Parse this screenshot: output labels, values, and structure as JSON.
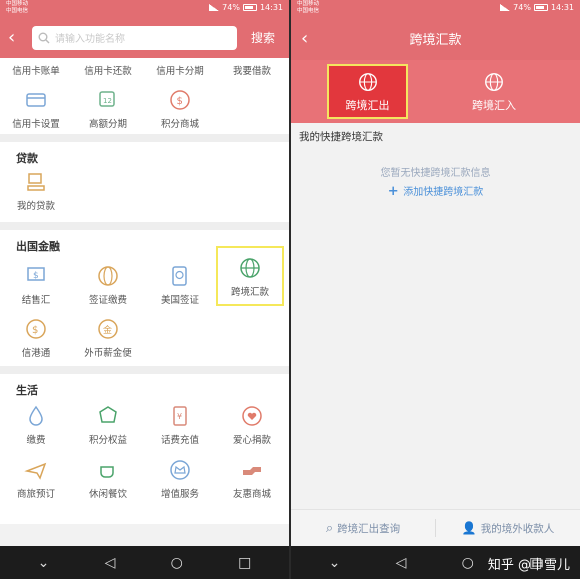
{
  "status": {
    "carrier1": "中国移动",
    "carrier2": "中国电信",
    "battery": "74%",
    "time": "14:31"
  },
  "left": {
    "search_placeholder": "请输入功能名称",
    "search_button": "搜索",
    "top_row": [
      "信用卡账单",
      "信用卡还款",
      "信用卡分期",
      "我要借款"
    ],
    "row2": [
      {
        "label": "信用卡设置",
        "icon": "card-settings-icon"
      },
      {
        "label": "高额分期",
        "icon": "installment-icon"
      },
      {
        "label": "积分商城",
        "icon": "points-mall-icon"
      }
    ],
    "loan_title": "贷款",
    "loan_items": [
      {
        "label": "我的贷款",
        "icon": "my-loan-icon"
      }
    ],
    "abroad_title": "出国金融",
    "abroad_row1": [
      {
        "label": "结售汇",
        "icon": "exchange-icon"
      },
      {
        "label": "签证缴费",
        "icon": "visa-fee-icon"
      },
      {
        "label": "美国签证",
        "icon": "us-visa-icon"
      },
      {
        "label": "跨境汇款",
        "icon": "cross-border-icon"
      }
    ],
    "abroad_row2": [
      {
        "label": "信港通",
        "icon": "hk-link-icon"
      },
      {
        "label": "外币薪金便",
        "icon": "salary-icon"
      }
    ],
    "life_title": "生活",
    "life_row1": [
      {
        "label": "缴费",
        "icon": "water-drop-icon"
      },
      {
        "label": "积分权益",
        "icon": "rights-icon"
      },
      {
        "label": "话费充值",
        "icon": "phone-topup-icon"
      },
      {
        "label": "爱心捐款",
        "icon": "heart-icon"
      }
    ],
    "life_row2": [
      {
        "label": "商旅预订",
        "icon": "plane-icon"
      },
      {
        "label": "休闲餐饮",
        "icon": "coffee-icon"
      },
      {
        "label": "增值服务",
        "icon": "crown-icon"
      },
      {
        "label": "友惠商城",
        "icon": "handshake-icon"
      }
    ]
  },
  "right": {
    "title": "跨境汇款",
    "tab_out": "跨境汇出",
    "tab_in": "跨境汇入",
    "section": "我的快捷跨境汇款",
    "empty": "您暂无快捷跨境汇款信息",
    "add": "添加快捷跨境汇款",
    "footer_left": "跨境汇出查询",
    "footer_right": "我的境外收款人",
    "watermark": "知乎 @申雪儿"
  },
  "colors": {
    "header": "#e26d72",
    "accent": "#e2373d",
    "icon": "#d9a55a",
    "highlight": "#f4e660"
  }
}
